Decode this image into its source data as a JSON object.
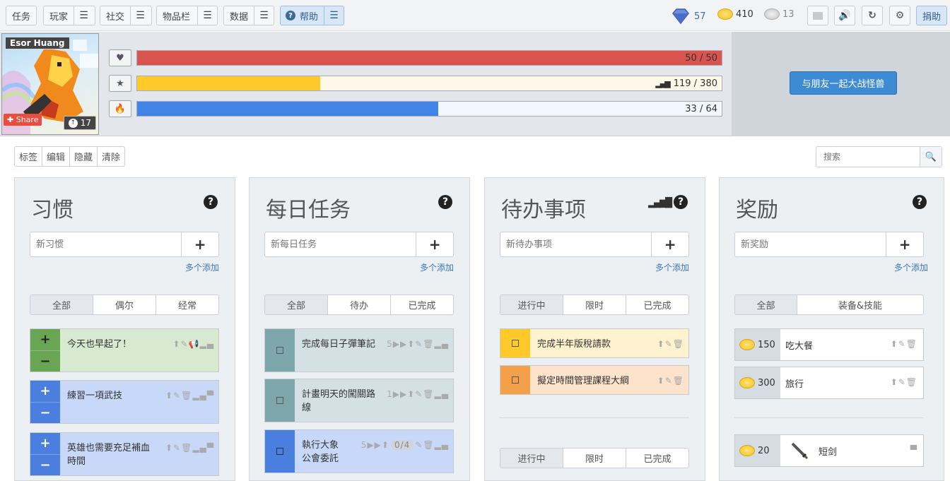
{
  "nav": {
    "items": [
      {
        "label": "任务",
        "has_menu": false
      },
      {
        "label": "玩家",
        "has_menu": true
      },
      {
        "label": "社交",
        "has_menu": true
      },
      {
        "label": "物品栏",
        "has_menu": true
      },
      {
        "label": "数据",
        "has_menu": true
      },
      {
        "label": "帮助",
        "has_menu": true,
        "active": true
      }
    ],
    "gems": "57",
    "gold": "410",
    "silver": "13",
    "donate_label": "捐助",
    "menu_glyph": "☰"
  },
  "profile": {
    "name": "Esor Huang",
    "share_label": "Share",
    "level": "17"
  },
  "stats": {
    "health": {
      "value": 50,
      "max": 50,
      "text": "50 / 50",
      "color": "#d9534f"
    },
    "experience": {
      "value": 119,
      "max": 380,
      "text": "119 / 380",
      "color": "#ffc929"
    },
    "mana": {
      "value": 33,
      "max": 64,
      "text": "33 / 64",
      "color": "#4284e5"
    }
  },
  "boss_button": "与朋友一起大战怪兽",
  "toolbar": {
    "tags": "标签",
    "edit": "编辑",
    "hide": "隐藏",
    "clear": "清除",
    "search_placeholder": "搜索"
  },
  "columns": {
    "habits": {
      "title": "习惯",
      "placeholder": "新习惯",
      "multi": "多个添加",
      "filters": [
        "全部",
        "偶尔",
        "经常"
      ],
      "tasks": [
        {
          "text": "今天也早起了！",
          "color": "#d7ead0",
          "ctrl": "#69a553"
        },
        {
          "text": "練習一項武技",
          "color": "#c8d8f8",
          "ctrl": "#4a7fe0"
        },
        {
          "text": "英雄也需要充足補血時間",
          "color": "#c8d8f8",
          "ctrl": "#4a7fe0"
        }
      ]
    },
    "dailies": {
      "title": "每日任务",
      "placeholder": "新每日任务",
      "multi": "多个添加",
      "filters": [
        "全部",
        "待办",
        "已完成"
      ],
      "tasks": [
        {
          "text": "完成每日子彈筆記",
          "streak": "5",
          "color": "#d5e0e4",
          "ctrl": "#7ea7ac"
        },
        {
          "text": "計畫明天的闖關路線",
          "streak": "1",
          "color": "#d5e0e4",
          "ctrl": "#7ea7ac"
        },
        {
          "text": "執行大象公會委託",
          "streak": "5",
          "checklist": "0/4",
          "color": "#c8d8f8",
          "ctrl": "#4a7fe0"
        }
      ]
    },
    "todos": {
      "title": "待办事项",
      "placeholder": "新待办事项",
      "multi": "多个添加",
      "filters": [
        "进行中",
        "限时",
        "已完成"
      ],
      "filters2": [
        "进行中",
        "限时",
        "已完成"
      ],
      "tasks": [
        {
          "text": "完成半年版稅請款",
          "color": "#fff2cf",
          "ctrl": "#ffc929"
        },
        {
          "text": "擬定時間管理課程大綱",
          "color": "#fde3cb",
          "ctrl": "#f4a04a"
        }
      ]
    },
    "rewards": {
      "title": "奖励",
      "placeholder": "新奖励",
      "multi": "多个添加",
      "filters": [
        "全部",
        "装备&技能"
      ],
      "items": [
        {
          "price": "150",
          "name": "吃大餐"
        },
        {
          "price": "300",
          "name": "旅行"
        },
        {
          "price": "20",
          "name": "短剑"
        }
      ]
    }
  }
}
